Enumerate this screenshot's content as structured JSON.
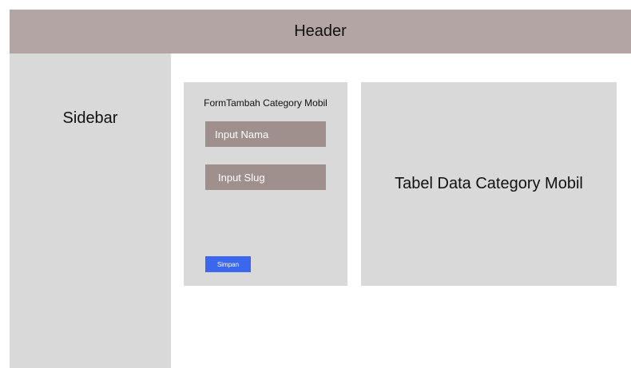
{
  "header": {
    "title": "Header"
  },
  "sidebar": {
    "title": "Sidebar"
  },
  "form": {
    "title": "FormTambah Category Mobil",
    "nama_placeholder": "Input Nama",
    "slug_placeholder": "Input Slug",
    "save_label": "Simpan"
  },
  "table": {
    "title": "Tabel Data Category Mobil"
  },
  "colors": {
    "header_bg": "#b3a5a3",
    "panel_bg": "#d9d9d9",
    "input_bg": "#9f908e",
    "button_bg": "#3b67ee"
  }
}
